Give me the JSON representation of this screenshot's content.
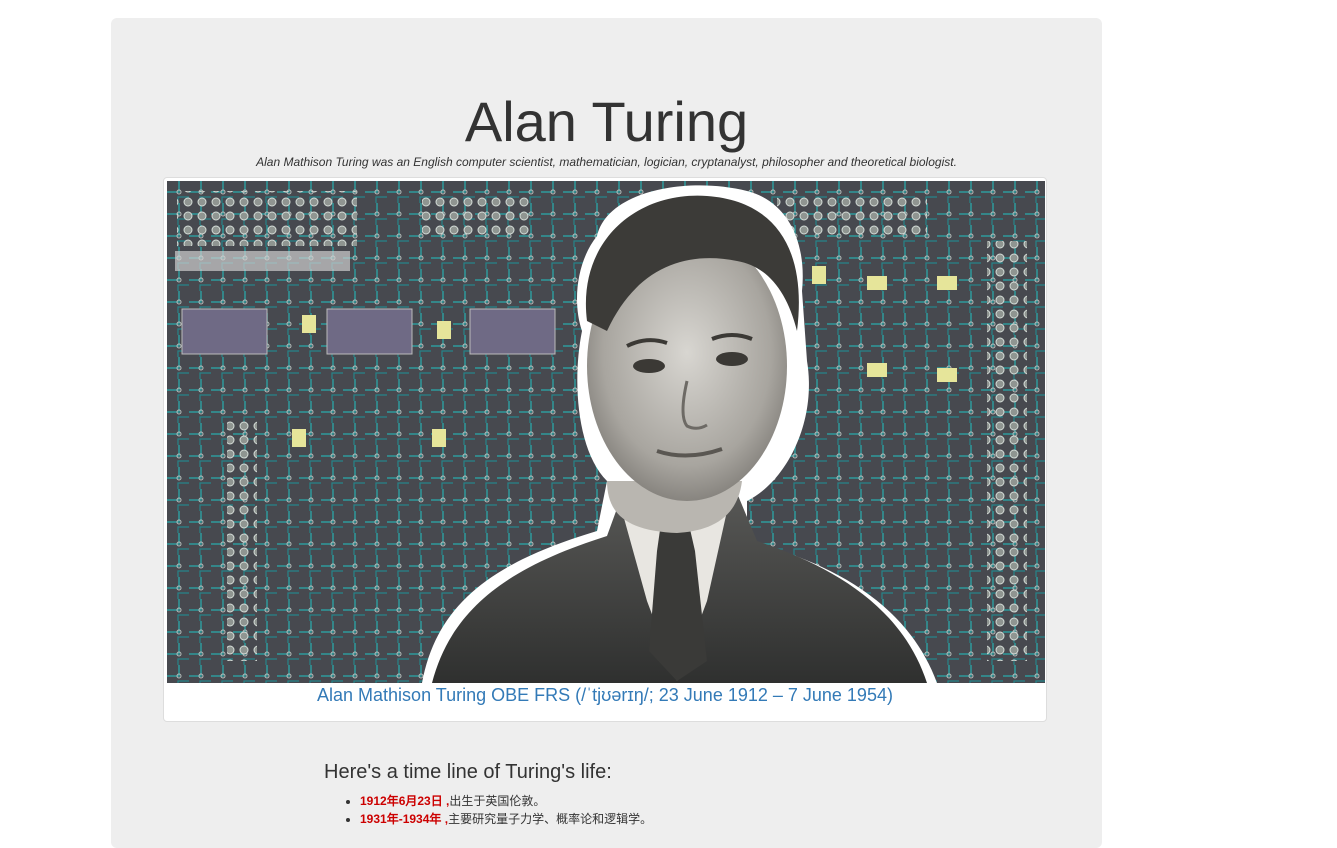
{
  "page": {
    "title": "Alan Turing",
    "subtitle": "Alan Mathison Turing was an English computer scientist, mathematician, logician, cryptanalyst, philosopher and theoretical biologist."
  },
  "figure": {
    "image_description": "Portrait of Alan Turing over a circuit board background",
    "caption": "Alan Mathison Turing OBE FRS (/ˈtjʊərɪŋ/; 23 June 1912 – 7 June 1954)"
  },
  "timeline": {
    "heading": "Here's a time line of Turing's life:",
    "items": [
      {
        "date": "1912年6月23日 ,",
        "text": "出生于英国伦敦。"
      },
      {
        "date": "1931年-1934年 ,",
        "text": "主要研究量子力学、概率论和逻辑学。"
      }
    ]
  },
  "colors": {
    "background": "#eeeeee",
    "caption_link": "#337ab7",
    "timeline_date": "#cc0000"
  }
}
